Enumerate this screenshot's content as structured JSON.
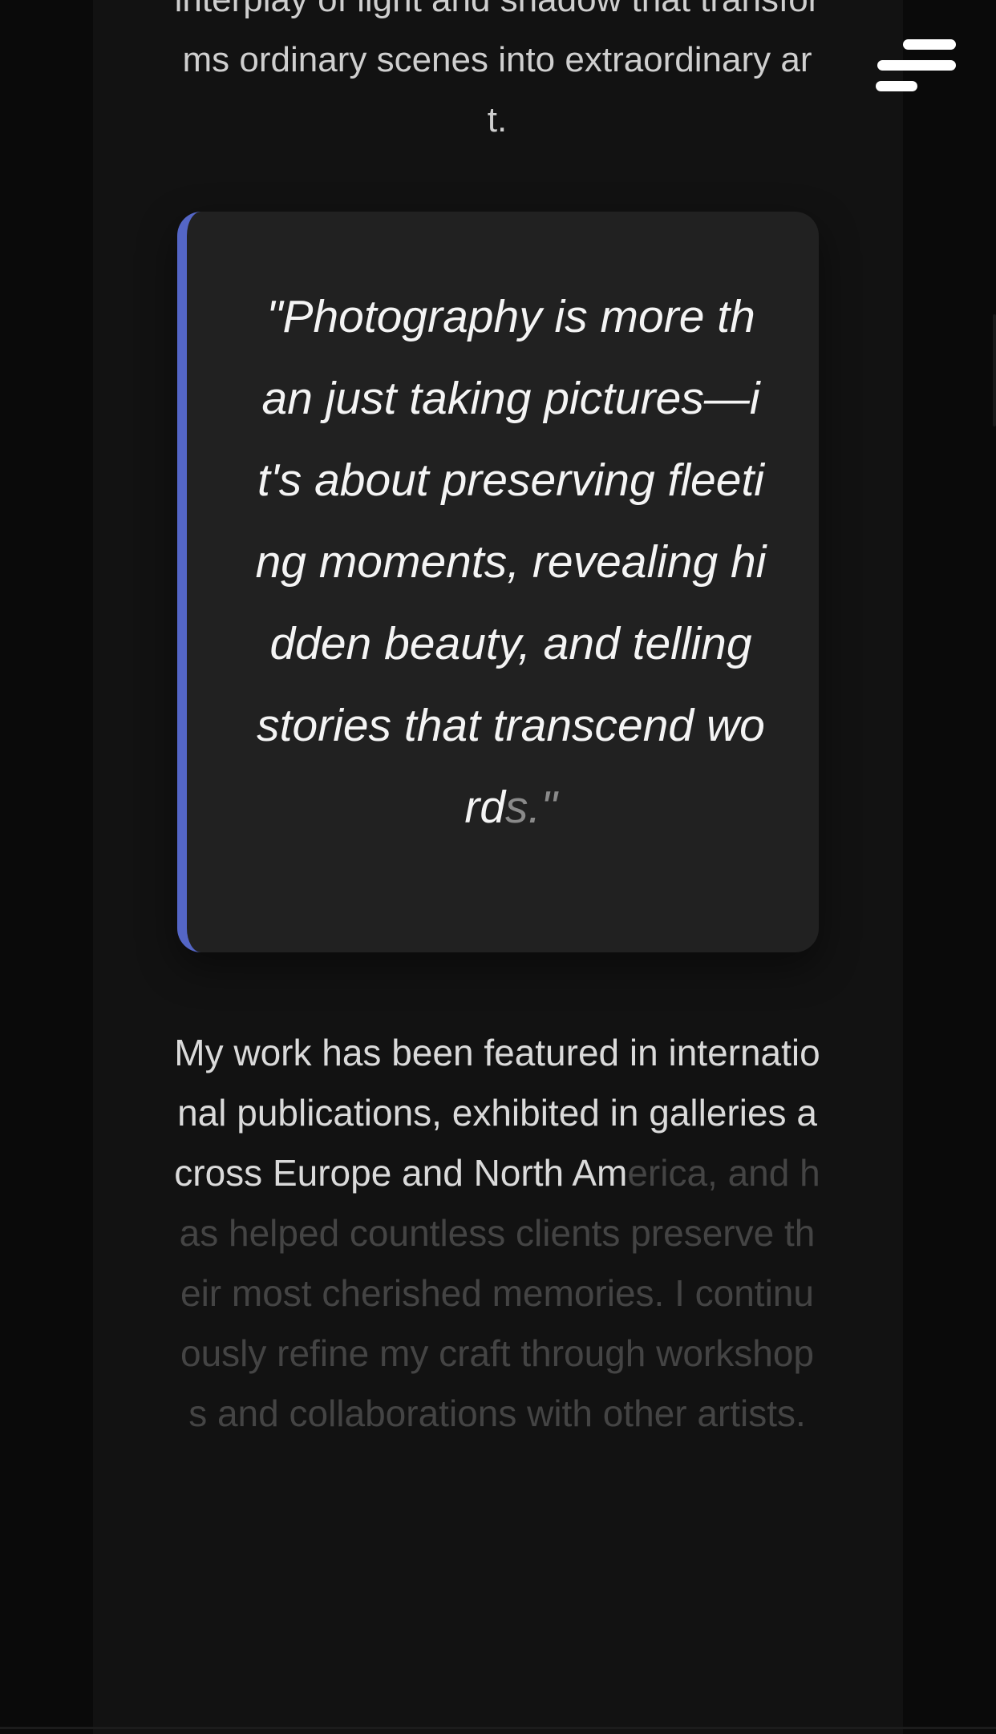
{
  "intro": {
    "text": "interplay of light and shadow that transforms ordinary scenes into extraordinary art."
  },
  "quote": {
    "visible": "\"Photography is more than just taking pictures—it's about preserving fleeting moments, revealing hidden beauty, and telling stories that transcend word",
    "fading": "s.\""
  },
  "body": {
    "visible": "My work has been featured in international publications, exhibited in galleries across Europe and North Am",
    "fading": "erica, and has helped countless clients preserve their most cherished memories. I continuously refine my craft through workshops and collaborations with other artists."
  },
  "menu": {
    "icon": "hamburger-menu-icon"
  },
  "colors": {
    "accent": "#5466c6",
    "background": "#121212",
    "card": "#212121"
  }
}
